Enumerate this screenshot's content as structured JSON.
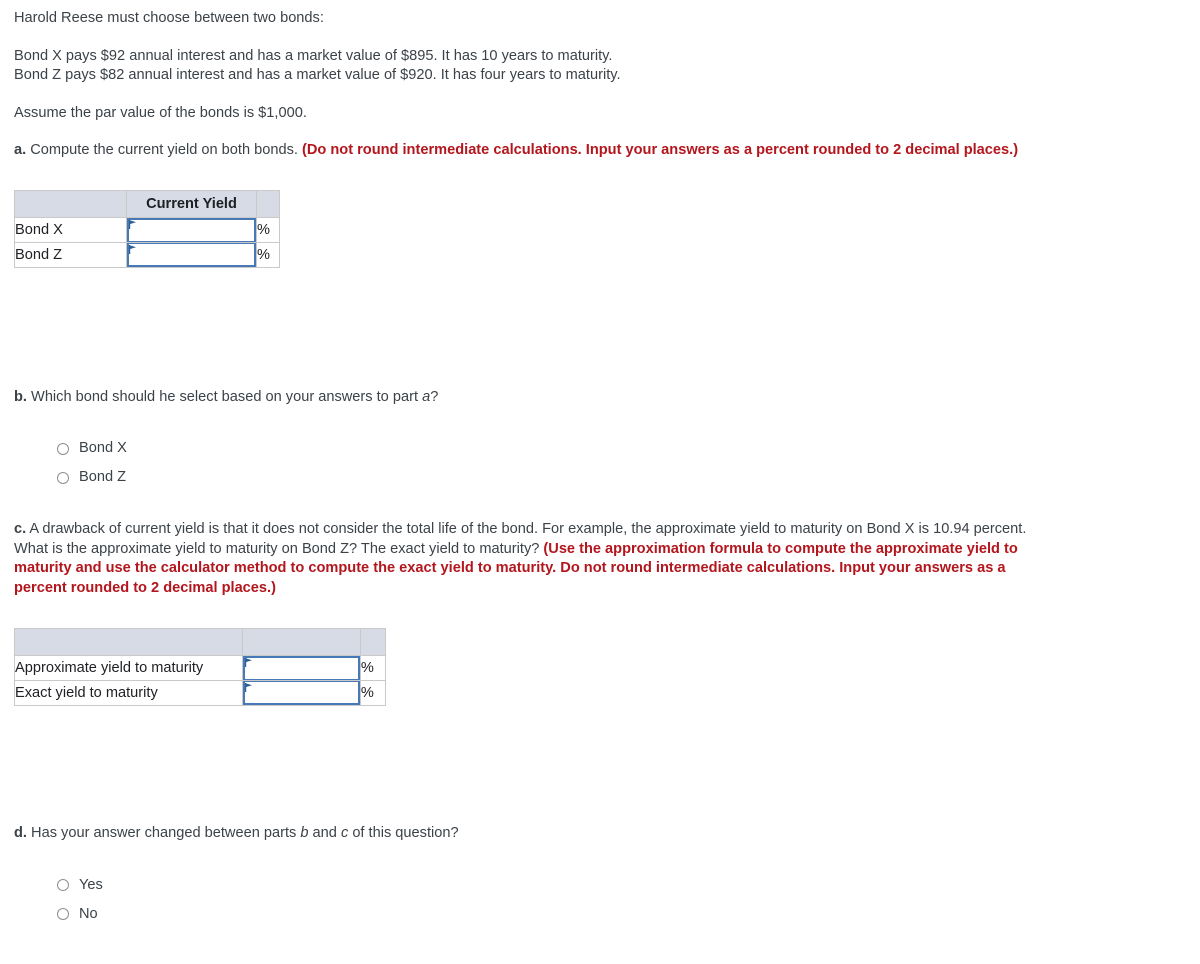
{
  "intro": {
    "line1": "Harold Reese must choose between two bonds:",
    "bond_x": "Bond X pays $92 annual interest and has a market value of $895. It has 10 years to maturity.",
    "bond_z": "Bond Z pays $82 annual interest and has a market value of $920. It has four years to maturity.",
    "par_value": "Assume the par value of the bonds is $1,000."
  },
  "part_a": {
    "marker": "a.",
    "prompt": " Compute the current yield on both bonds. ",
    "instruction": "(Do not round intermediate calculations. Input your answers as a percent rounded to 2 decimal places.)",
    "table": {
      "headers": [
        "",
        "Current Yield",
        ""
      ],
      "rows": [
        {
          "label": "Bond X",
          "value": "",
          "unit": "%"
        },
        {
          "label": "Bond Z",
          "value": "",
          "unit": "%"
        }
      ]
    }
  },
  "part_b": {
    "marker": "b.",
    "prompt_1": " Which bond should he select based on your answers to part ",
    "prompt_italic": "a",
    "prompt_2": "?",
    "options": [
      "Bond X",
      "Bond Z"
    ]
  },
  "part_c": {
    "marker": "c.",
    "prompt": " A drawback of current yield is that it does not consider the total life of the bond. For example, the approximate yield to maturity on Bond X is 10.94 percent. What is the approximate yield to maturity on Bond Z? The exact yield to maturity? ",
    "instruction": "(Use the approximation formula to compute the approximate yield to maturity and use the calculator method to compute the exact yield to maturity. Do not round intermediate calculations. Input your answers as a percent rounded to 2 decimal places.)",
    "table": {
      "headers": [
        "",
        "",
        ""
      ],
      "rows": [
        {
          "label": "Approximate yield to maturity",
          "value": "",
          "unit": "%"
        },
        {
          "label": "Exact yield to maturity",
          "value": "",
          "unit": "%"
        }
      ]
    }
  },
  "part_d": {
    "marker": "d.",
    "prompt_1": " Has your answer changed between parts ",
    "prompt_italic_1": "b",
    "prompt_mid": " and ",
    "prompt_italic_2": "c",
    "prompt_2": " of this question?",
    "options": [
      "Yes",
      "No"
    ]
  },
  "colors": {
    "red": "#b3161d",
    "header_bg": "#d7dbe6",
    "input_border": "#4679b5",
    "text": "#3b4248"
  }
}
